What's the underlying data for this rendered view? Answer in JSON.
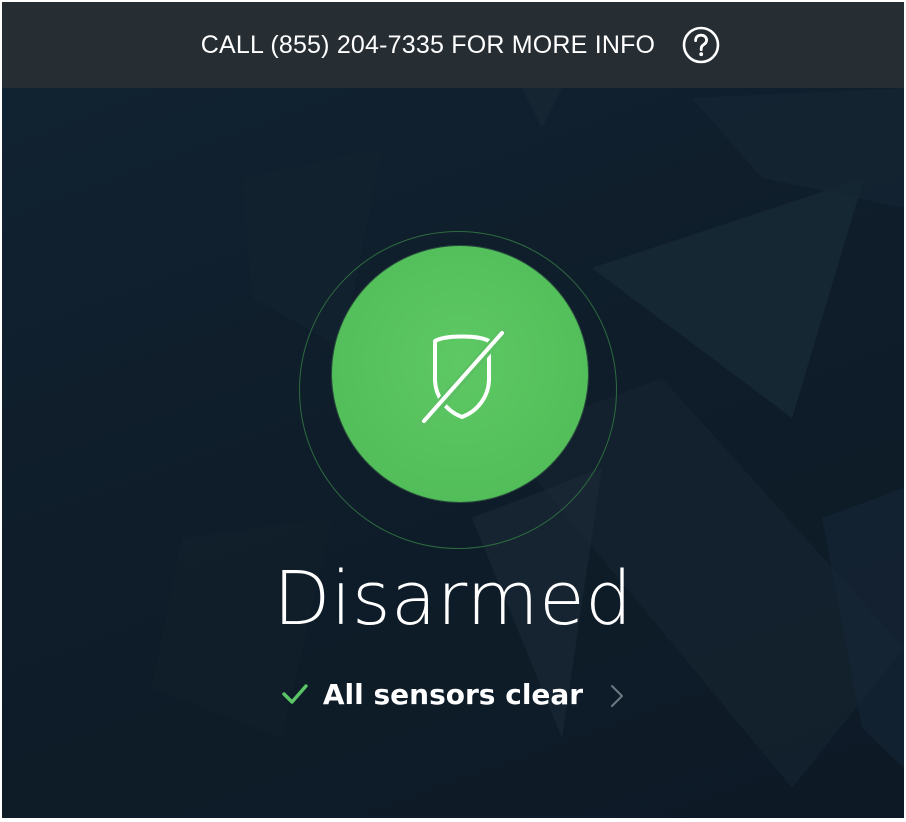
{
  "header": {
    "call_text": "CALL (855) 204-7335 FOR MORE INFO",
    "help_icon": "question-circle-icon"
  },
  "status": {
    "title": "Disarmed",
    "icon": "shield-slash-icon",
    "sensors_text": "All sensors clear",
    "sensors_icon": "checkmark-icon",
    "sensors_chevron": "chevron-right-icon"
  },
  "colors": {
    "accent_green": "#54c05b",
    "check_green": "#5cc667",
    "background": "#0f1f2c",
    "topbar": "#262e34"
  }
}
